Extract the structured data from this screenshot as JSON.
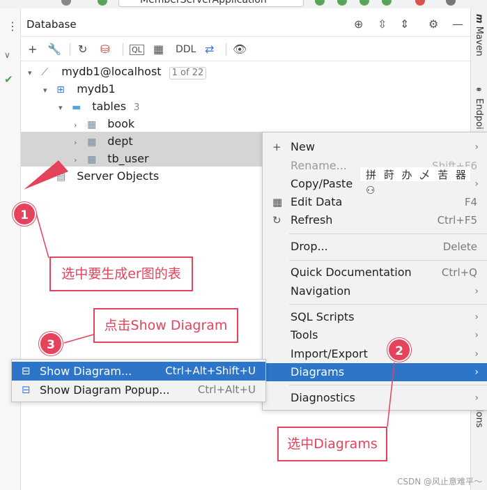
{
  "top_strip": {
    "app_name": "MemberServerApplication"
  },
  "panel": {
    "title": "Database",
    "header_icons": [
      "crosshair-icon",
      "expand-all-icon",
      "collapse-all-icon",
      "gear-icon",
      "minimize-icon"
    ]
  },
  "toolbar": {
    "ddl_label": "DDL"
  },
  "side_tabs": {
    "maven": "Maven",
    "endpoints": "Endpoi",
    "notifications": "ions"
  },
  "tree": {
    "connection": {
      "label": "mydb1@localhost",
      "badge": "1 of 22"
    },
    "database": "mydb1",
    "tables": {
      "label": "tables",
      "count": "3"
    },
    "table_items": [
      "book",
      "dept",
      "tb_user"
    ],
    "server_objects": "Server Objects"
  },
  "context_menu": {
    "items": [
      {
        "label": "New",
        "shortcut": "",
        "arrow": true,
        "icon": "plus-icon"
      },
      {
        "label": "Rename...",
        "shortcut": "Shift+F6",
        "disabled": true
      },
      {
        "label": "Copy/Paste",
        "shortcut": "",
        "arrow": true
      },
      {
        "label": "Edit Data",
        "shortcut": "F4",
        "icon": "table-icon"
      },
      {
        "label": "Refresh",
        "shortcut": "Ctrl+F5",
        "icon": "refresh-icon"
      },
      {
        "label": "Drop...",
        "shortcut": "Delete"
      },
      {
        "label": "Quick Documentation",
        "shortcut": "Ctrl+Q"
      },
      {
        "label": "Navigation",
        "arrow": true
      },
      {
        "label": "SQL Scripts",
        "arrow": true
      },
      {
        "label": "Tools",
        "arrow": true
      },
      {
        "label": "Import/Export",
        "arrow": true
      },
      {
        "label": "Diagrams",
        "arrow": true,
        "active": true
      },
      {
        "label": "Diagnostics",
        "arrow": true
      }
    ],
    "ime_text": "拼 莳 办 乄 苦 器 ⚇"
  },
  "submenu": {
    "items": [
      {
        "label": "Show Diagram...",
        "shortcut": "Ctrl+Alt+Shift+U",
        "active": true
      },
      {
        "label": "Show Diagram Popup...",
        "shortcut": "Ctrl+Alt+U"
      }
    ]
  },
  "annotations": {
    "step1": {
      "number": "1",
      "text": "选中要生成er图的表"
    },
    "step2": {
      "number": "2",
      "text": "选中Diagrams"
    },
    "step3": {
      "number": "3",
      "text": "点击Show Diagram"
    },
    "accent_color": "#e5425c"
  },
  "selection_color": "#2c75c9",
  "watermark": "CSDN @风止意难平～"
}
